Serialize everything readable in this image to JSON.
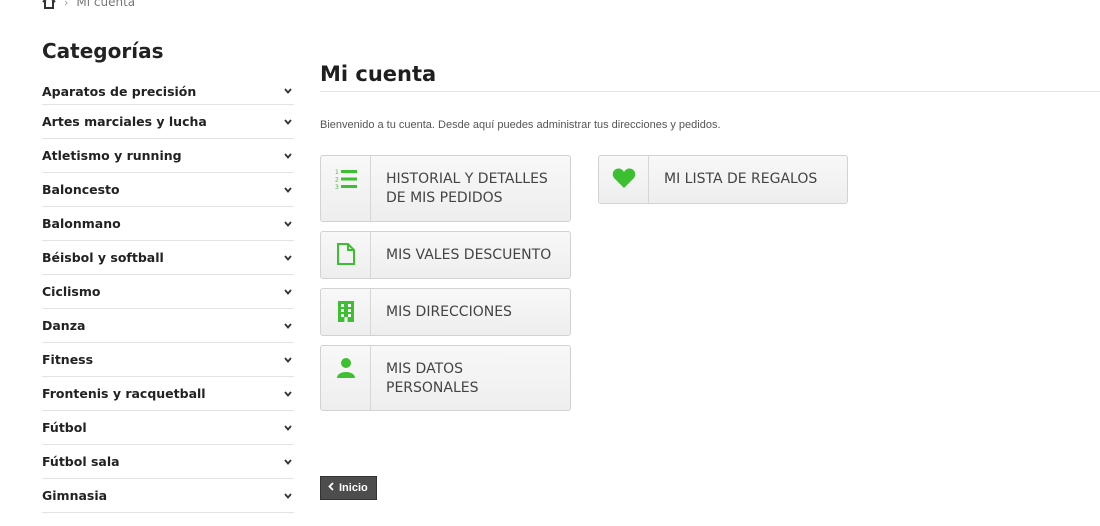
{
  "breadcrumb": {
    "current": "Mi cuenta"
  },
  "sidebar": {
    "title": "Categorías",
    "items": [
      "Aparatos de precisión",
      "Artes marciales y lucha",
      "Atletismo y running",
      "Baloncesto",
      "Balonmano",
      "Béisbol y softball",
      "Ciclismo",
      "Danza",
      "Fitness",
      "Frontenis y racquetball",
      "Fútbol",
      "Fútbol sala",
      "Gimnasia"
    ]
  },
  "main": {
    "title": "Mi cuenta",
    "welcome": "Bienvenido a tu cuenta. Desde aquí puedes administrar tus direcciones y pedidos.",
    "buttons": {
      "history": "HISTORIAL Y DETALLES DE MIS PEDIDOS",
      "vouchers": "MIS VALES DESCUENTO",
      "addresses": "MIS DIRECCIONES",
      "personal": "MIS DATOS PERSONALES",
      "gifts": "MI LISTA DE REGALOS"
    },
    "home_button": "Inicio"
  },
  "colors": {
    "accent": "#3cc031",
    "home_button_bg": "#4d4d4d"
  }
}
